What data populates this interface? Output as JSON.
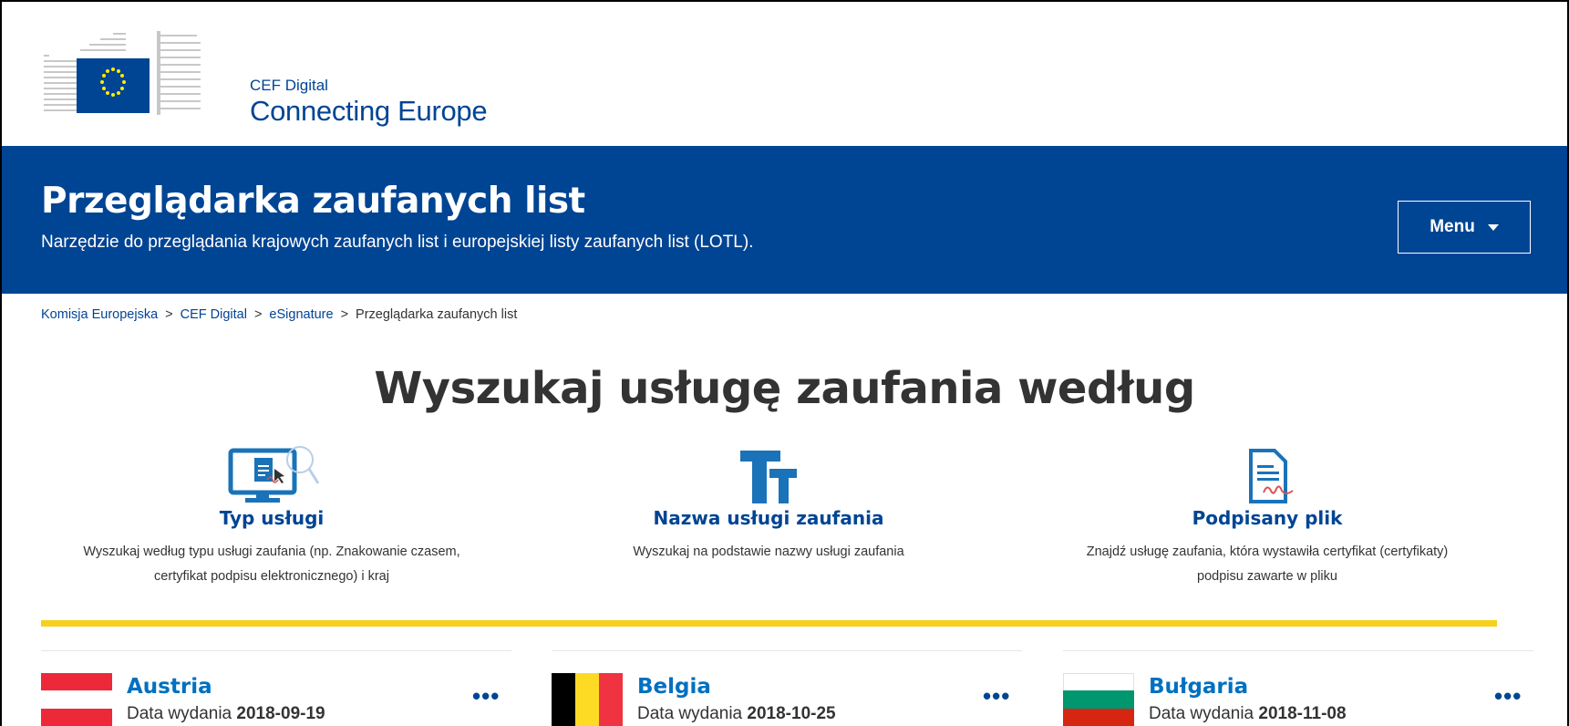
{
  "logo": {
    "line1": "CEF Digital",
    "line2": "Connecting Europe"
  },
  "banner": {
    "title": "Przeglądarka zaufanych list",
    "subtitle": "Narzędzie do przeglądania krajowych zaufanych list i europejskiej listy zaufanych list (LOTL).",
    "menu_label": "Menu"
  },
  "breadcrumb": [
    "Komisja Europejska",
    "CEF Digital",
    "eSignature",
    "Przeglądarka zaufanych list"
  ],
  "breadcrumb_separator": ">",
  "main_title": "Wyszukaj usługę zaufania według",
  "options": [
    {
      "title": "Typ usługi",
      "desc_line1": "Wyszukaj według typu usługi zaufania (np. Znakowanie czasem,",
      "desc_line2": "certyfikat podpisu elektronicznego) i kraj",
      "icon": "monitor-search-icon"
    },
    {
      "title": "Nazwa usługi zaufania",
      "desc_line1": "Wyszukaj na podstawie nazwy usługi zaufania",
      "desc_line2": "",
      "icon": "text-size-icon"
    },
    {
      "title": "Podpisany plik",
      "desc_line1": "Znajdź usługę zaufania, która wystawiła certyfikat (certyfikaty)",
      "desc_line2": "podpisu zawarte w pliku",
      "icon": "signed-document-icon"
    }
  ],
  "countries": [
    {
      "name": "Austria",
      "date_label": "Data wydania",
      "date": "2018-09-19"
    },
    {
      "name": "Belgia",
      "date_label": "Data wydania",
      "date": "2018-10-25"
    },
    {
      "name": "Bułgaria",
      "date_label": "Data wydania",
      "date": "2018-11-08"
    }
  ],
  "more_label": "•••",
  "colors": {
    "brand_blue": "#004494",
    "link_blue": "#0070c0",
    "accent_yellow": "#f6d01a",
    "icon_blue": "#1a73b8"
  }
}
